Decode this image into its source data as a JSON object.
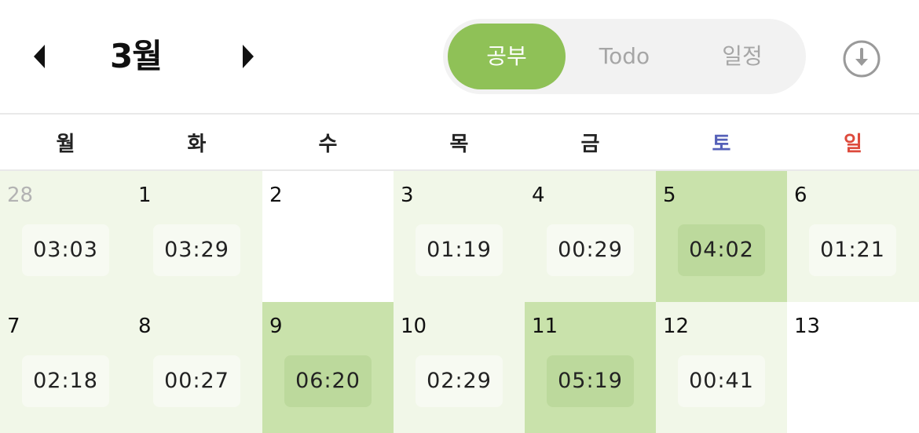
{
  "header": {
    "month_title": "3월",
    "prev_icon": "caret-left-icon",
    "next_icon": "caret-right-icon",
    "download_icon": "download-circle-icon",
    "tabs": [
      {
        "label": "공부",
        "active": true
      },
      {
        "label": "Todo",
        "active": false
      },
      {
        "label": "일정",
        "active": false
      }
    ],
    "accent_color": "#8fc157"
  },
  "weekdays": [
    "월",
    "화",
    "수",
    "목",
    "금",
    "토",
    "일"
  ],
  "weekday_colors": {
    "saturday": "#5560b8",
    "sunday": "#dd4a3c"
  },
  "weeks": [
    [
      {
        "day": "28",
        "time": "03:03",
        "level": 1,
        "other_month": true
      },
      {
        "day": "1",
        "time": "03:29",
        "level": 1
      },
      {
        "day": "2",
        "time": "",
        "level": 0
      },
      {
        "day": "3",
        "time": "01:19",
        "level": 1
      },
      {
        "day": "4",
        "time": "00:29",
        "level": 1
      },
      {
        "day": "5",
        "time": "04:02",
        "level": 2
      },
      {
        "day": "6",
        "time": "01:21",
        "level": 1
      }
    ],
    [
      {
        "day": "7",
        "time": "02:18",
        "level": 1
      },
      {
        "day": "8",
        "time": "00:27",
        "level": 1
      },
      {
        "day": "9",
        "time": "06:20",
        "level": 2
      },
      {
        "day": "10",
        "time": "02:29",
        "level": 1
      },
      {
        "day": "11",
        "time": "05:19",
        "level": 2
      },
      {
        "day": "12",
        "time": "00:41",
        "level": 1
      },
      {
        "day": "13",
        "time": "",
        "level": 0
      }
    ]
  ]
}
